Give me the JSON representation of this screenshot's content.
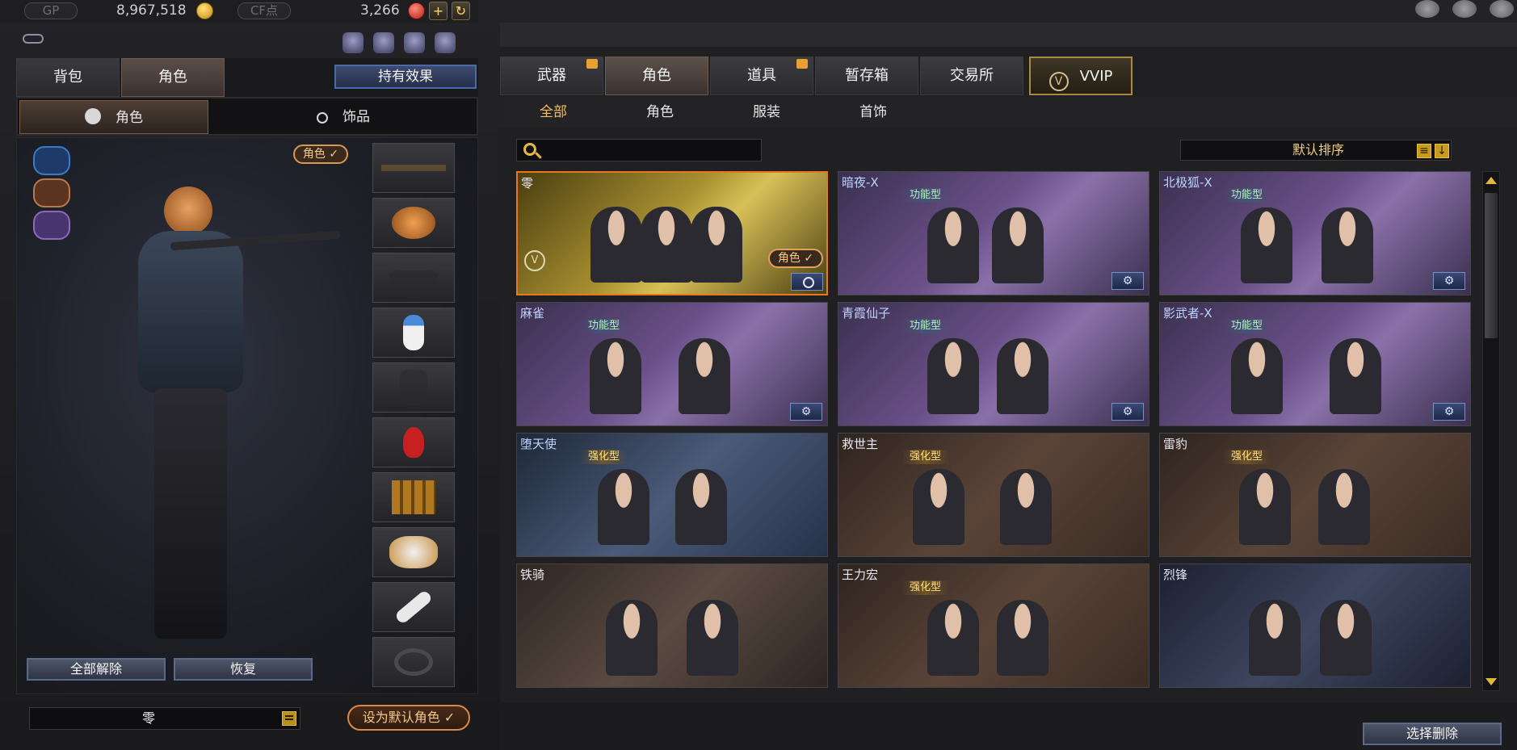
{
  "currency": {
    "gp_label": "GP",
    "gp_value": "8,967,518",
    "cf_label": "CF点",
    "cf_value": "3,266"
  },
  "left": {
    "tabs": [
      {
        "label": "背包",
        "active": false
      },
      {
        "label": "角色",
        "active": true
      }
    ],
    "effect_button": "持有效果",
    "subtabs": [
      {
        "label": "角色",
        "icon": "character-icon",
        "active": true
      },
      {
        "label": "饰品",
        "icon": "ring-icon",
        "active": false
      }
    ],
    "stage_tag": "角色 ✓",
    "slots": [
      {
        "icon": "sniper-rifle-icon"
      },
      {
        "icon": "tiger-mask-icon"
      },
      {
        "icon": "sunglasses-icon"
      },
      {
        "icon": "snowman-icon"
      },
      {
        "icon": "backpack-icon"
      },
      {
        "icon": "ornament-icon"
      },
      {
        "icon": "ammo-belt-icon"
      },
      {
        "icon": "dragon-pet-icon"
      },
      {
        "icon": "shuttlecock-icon"
      },
      {
        "icon": "armband-icon"
      }
    ],
    "release_all": "全部解除",
    "restore": "恢复",
    "current_name": "零",
    "set_default": "设为默认角色 ✓"
  },
  "right": {
    "tabs": [
      {
        "label": "武器",
        "gift": true
      },
      {
        "label": "角色",
        "active": true
      },
      {
        "label": "道具",
        "gift": true
      },
      {
        "label": "暂存箱"
      },
      {
        "label": "交易所"
      },
      {
        "label": "VVIP",
        "vvip": true
      }
    ],
    "filters": [
      {
        "label": "全部",
        "active": true
      },
      {
        "label": "角色"
      },
      {
        "label": "服装"
      },
      {
        "label": "首饰"
      }
    ],
    "search": {
      "placeholder": ""
    },
    "sort_label": "默认排序",
    "cards": [
      {
        "name": "零",
        "type": "",
        "style": "gold",
        "role_tag": "角色 ✓",
        "vip": "V"
      },
      {
        "name": "暗夜-X",
        "type": "功能型",
        "style": "func"
      },
      {
        "name": "北极狐-X",
        "type": "功能型",
        "style": "func"
      },
      {
        "name": "麻雀",
        "type": "功能型",
        "style": "func"
      },
      {
        "name": "青霞仙子",
        "type": "功能型",
        "style": "func"
      },
      {
        "name": "影武者-X",
        "type": "功能型",
        "style": "func"
      },
      {
        "name": "堕天使",
        "type": "强化型",
        "style": "strong blue"
      },
      {
        "name": "救世主",
        "type": "强化型",
        "style": "strong"
      },
      {
        "name": "雷豹",
        "type": "强化型",
        "style": "strong"
      },
      {
        "name": "铁骑",
        "type": "",
        "style": "plain"
      },
      {
        "name": "王力宏",
        "type": "强化型",
        "style": "strong"
      },
      {
        "name": "烈锋",
        "type": "",
        "style": "plain navy"
      }
    ],
    "select_delete": "选择删除"
  }
}
